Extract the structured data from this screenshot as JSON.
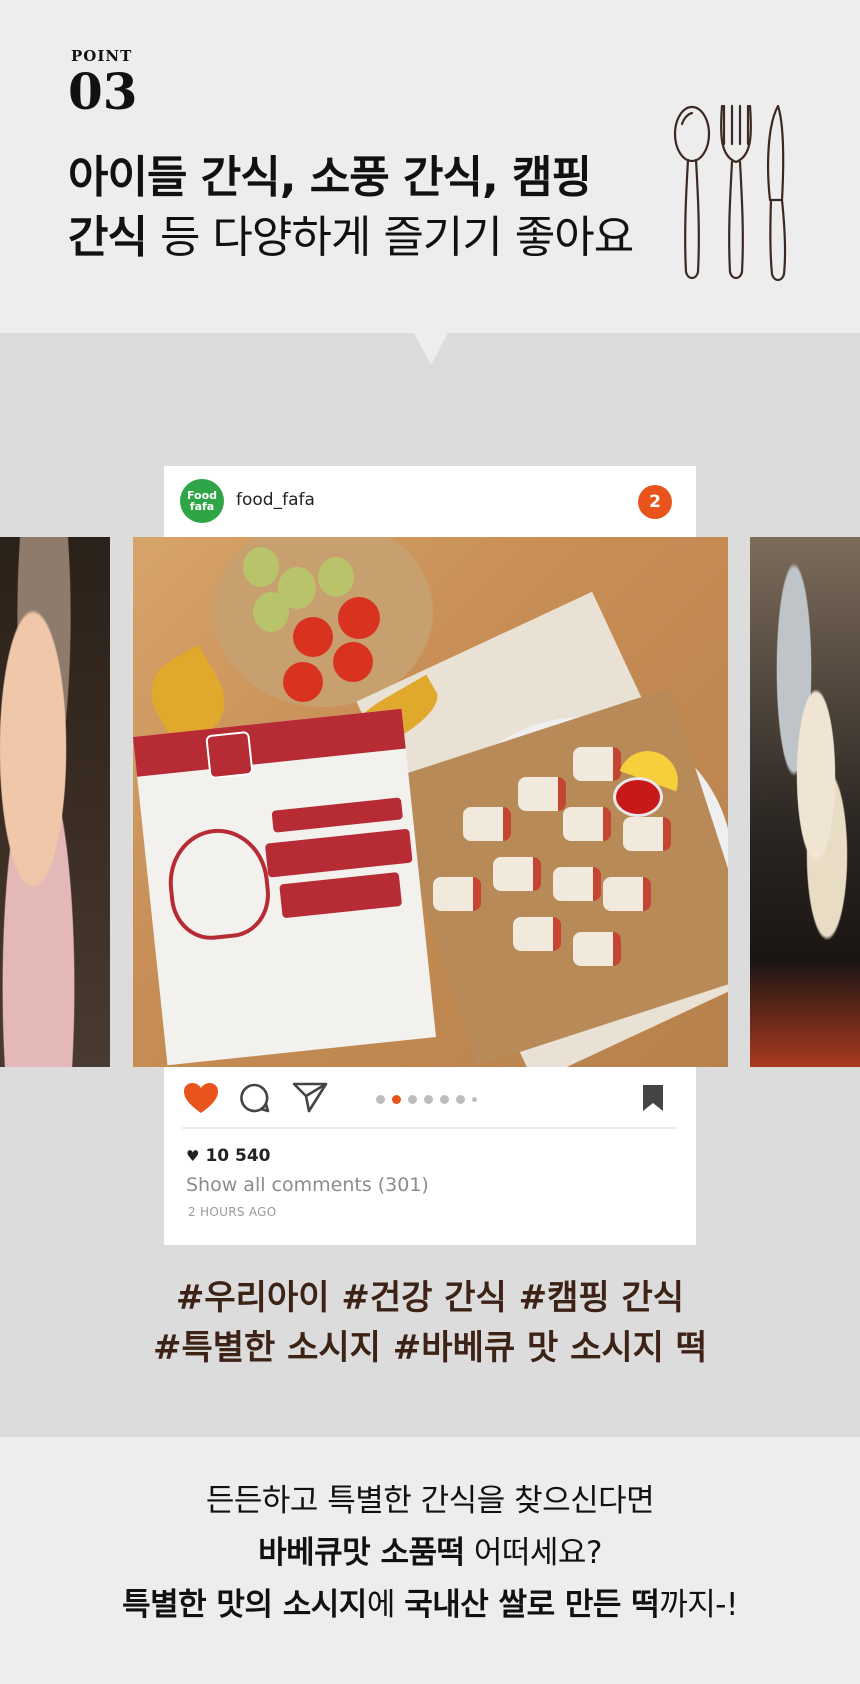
{
  "header": {
    "point_label": "POINT",
    "point_number": "03",
    "headline_line1": "아이들 간식, 소풍 간식, 캠핑",
    "headline_line2_bold": "간식",
    "headline_line2_rest": " 등 다양하게 즐기기 좋아요"
  },
  "post": {
    "avatar_text_1": "Food",
    "avatar_text_2": "fafa",
    "username": "food_fafa",
    "notification_count": "2",
    "likes_count": "10 540",
    "comments_link": "Show all comments (301)",
    "timestamp": "2 HOURS AGO",
    "carousel": {
      "total": 7,
      "active_index": 1
    }
  },
  "hashtags": {
    "line1": "#우리아이 #건강 간식 #캠핑 간식",
    "line2": "#특별한 소시지 #바베큐 맛 소시지 떡"
  },
  "footer": {
    "line1": "든든하고 특별한 간식을 찾으신다면",
    "line2_bold": "바베큐맛 소품떡",
    "line2_rest": " 어떠세요?",
    "line3_bold_a": "특별한 맛의 소시지",
    "line3_mid": "에 ",
    "line3_bold_b": "국내산 쌀로 만든 떡",
    "line3_end": "까지-!"
  },
  "colors": {
    "accent": "#e8541b",
    "brand_green": "#2fa548",
    "hashtag": "#3d2216",
    "pack_red": "#b72b35"
  },
  "icons": [
    "heart-icon",
    "comment-icon",
    "send-icon",
    "bookmark-icon",
    "spoon-icon",
    "fork-icon",
    "knife-icon"
  ]
}
